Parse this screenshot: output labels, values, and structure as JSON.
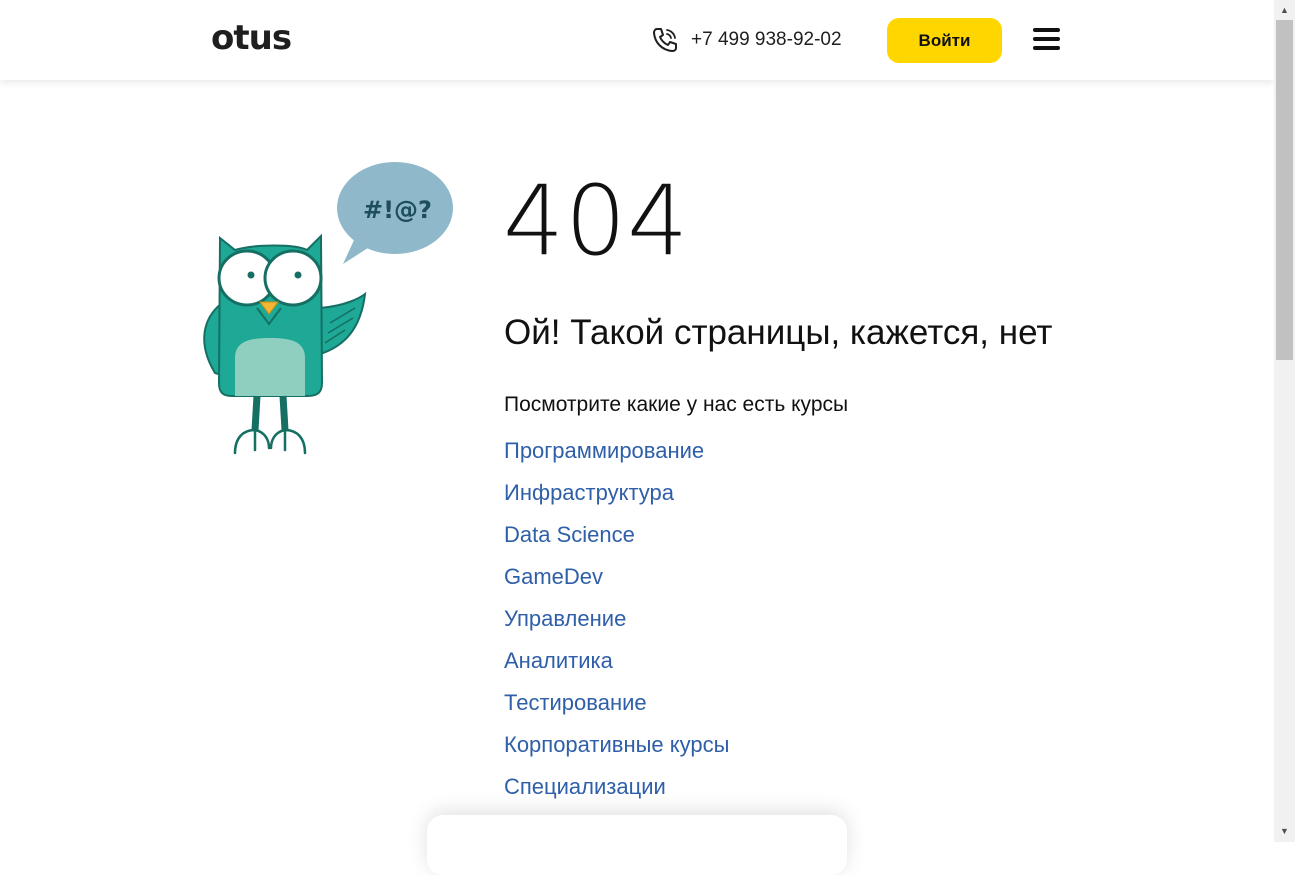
{
  "header": {
    "logo_text": "otus",
    "phone": "+7 499 938-92-02",
    "login_label": "Войти"
  },
  "owl": {
    "bubble_text": "#!@?"
  },
  "error": {
    "code": "404",
    "title": "Ой! Такой страницы, кажется, нет",
    "subtitle": "Посмотрите какие у нас есть курсы"
  },
  "courses": [
    "Программирование",
    "Инфраструктура",
    "Data Science",
    "GameDev",
    "Управление",
    "Аналитика",
    "Тестирование",
    "Корпоративные курсы",
    "Специализации"
  ],
  "colors": {
    "accent": "#ffd600",
    "link": "#2e5fa8",
    "owl_body": "#1ea896",
    "owl_belly": "#8fcfbf",
    "bubble": "#8fb8cb"
  },
  "icons": [
    "phone-icon",
    "menu-icon",
    "scroll-up-arrow-icon",
    "scroll-down-arrow-icon"
  ]
}
